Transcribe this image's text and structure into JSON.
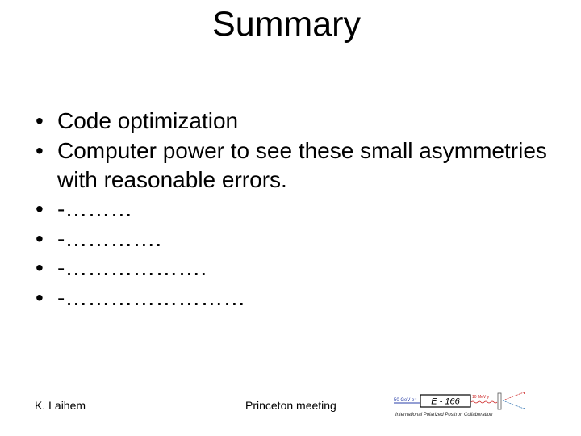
{
  "slide": {
    "title": "Summary",
    "bullets": [
      {
        "symbol": "•",
        "text": "Code optimization"
      },
      {
        "symbol": "•",
        "text": "Computer power to see these small asymmetries with reasonable errors."
      },
      {
        "symbol": "•",
        "text": "-………"
      },
      {
        "symbol": "•",
        "text": "-…………."
      },
      {
        "symbol": "•",
        "text": "-………………."
      },
      {
        "symbol": "•",
        "text": "-……………………"
      }
    ]
  },
  "footer": {
    "author": "K. Laihem",
    "event": "Princeton meeting"
  },
  "logo": {
    "beam_label": "50 GeV e⁻",
    "experiment": "E - 166",
    "photon_label": "10 MeV γ",
    "collaboration": "International Polarized Positron Collaboration",
    "colors": {
      "beam": "#2a3fa8",
      "photon": "#cc2222",
      "positron": "#cc2222",
      "electron": "#2a6fb0"
    }
  }
}
